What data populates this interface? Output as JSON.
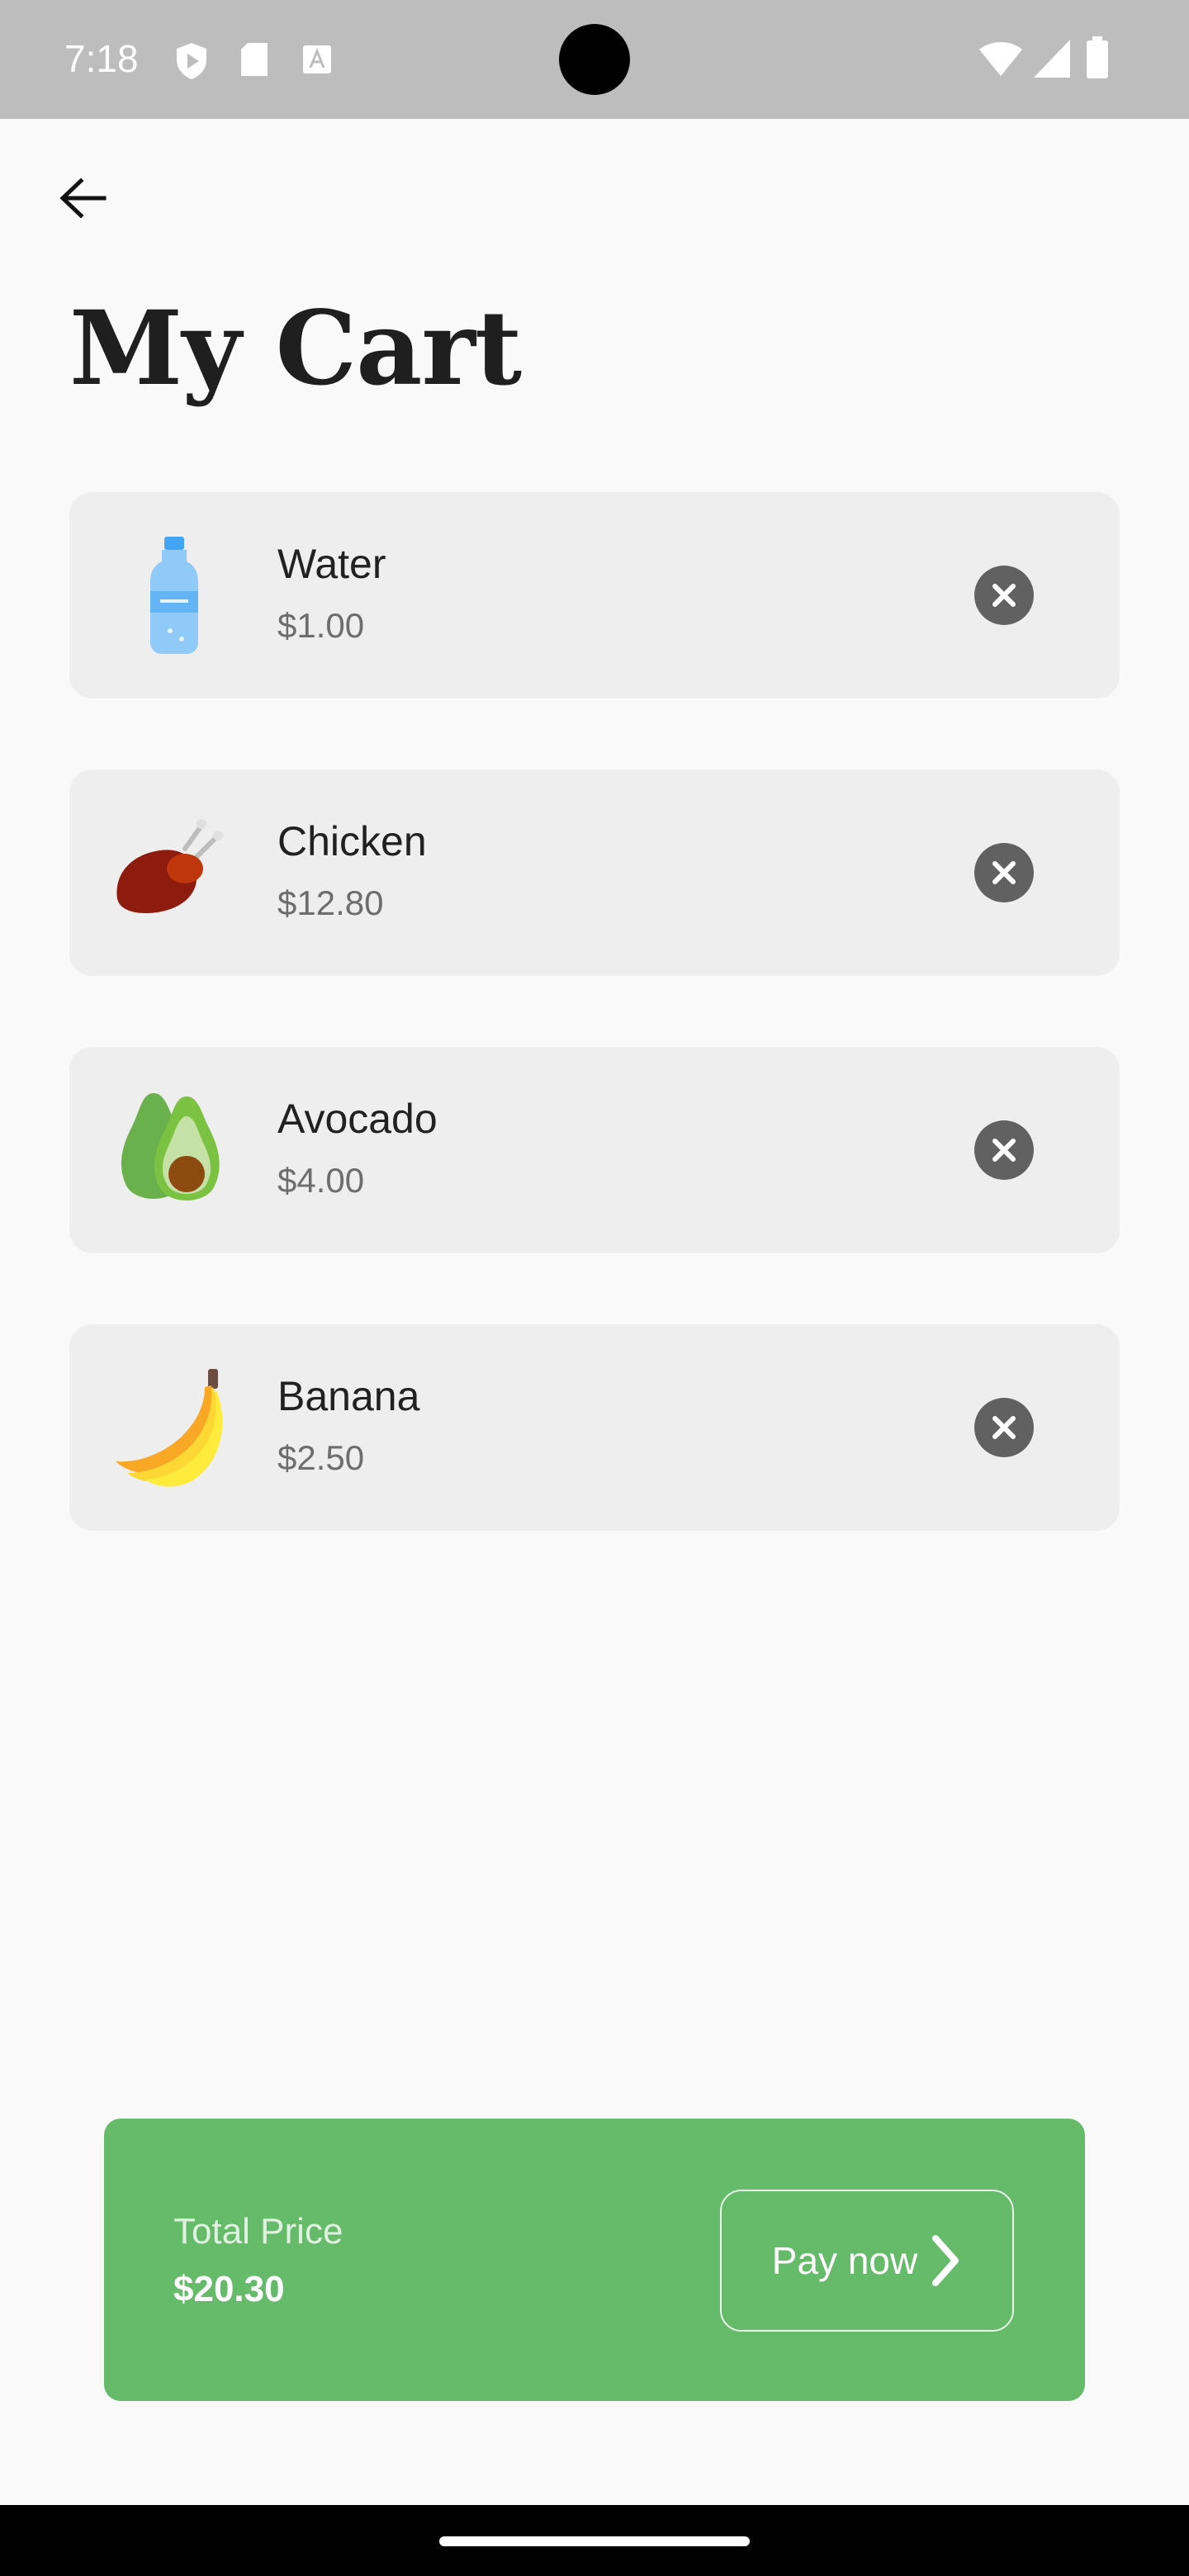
{
  "status_bar": {
    "time": "7:18",
    "left_icons": [
      "shield-play-icon",
      "sd-card-icon",
      "font-a-icon"
    ],
    "right_icons": [
      "wifi-icon",
      "signal-icon",
      "battery-icon"
    ]
  },
  "header": {
    "back_icon": "arrow-left-icon",
    "title": "My Cart"
  },
  "cart": {
    "items": [
      {
        "name": "Water",
        "price": "$1.00",
        "icon": "water-bottle-icon"
      },
      {
        "name": "Chicken",
        "price": "$12.80",
        "icon": "roast-chicken-icon"
      },
      {
        "name": "Avocado",
        "price": "$4.00",
        "icon": "avocado-icon"
      },
      {
        "name": "Banana",
        "price": "$2.50",
        "icon": "banana-icon"
      }
    ],
    "remove_icon": "close-circle-icon"
  },
  "checkout": {
    "total_label": "Total Price",
    "total_value": "$20.30",
    "pay_label": "Pay now",
    "pay_icon": "chevron-right-icon"
  },
  "colors": {
    "accent": "#66bb6a",
    "card_bg": "#eeeeee",
    "page_bg": "#f9f9f9",
    "status_bar": "#bdbdbd"
  }
}
